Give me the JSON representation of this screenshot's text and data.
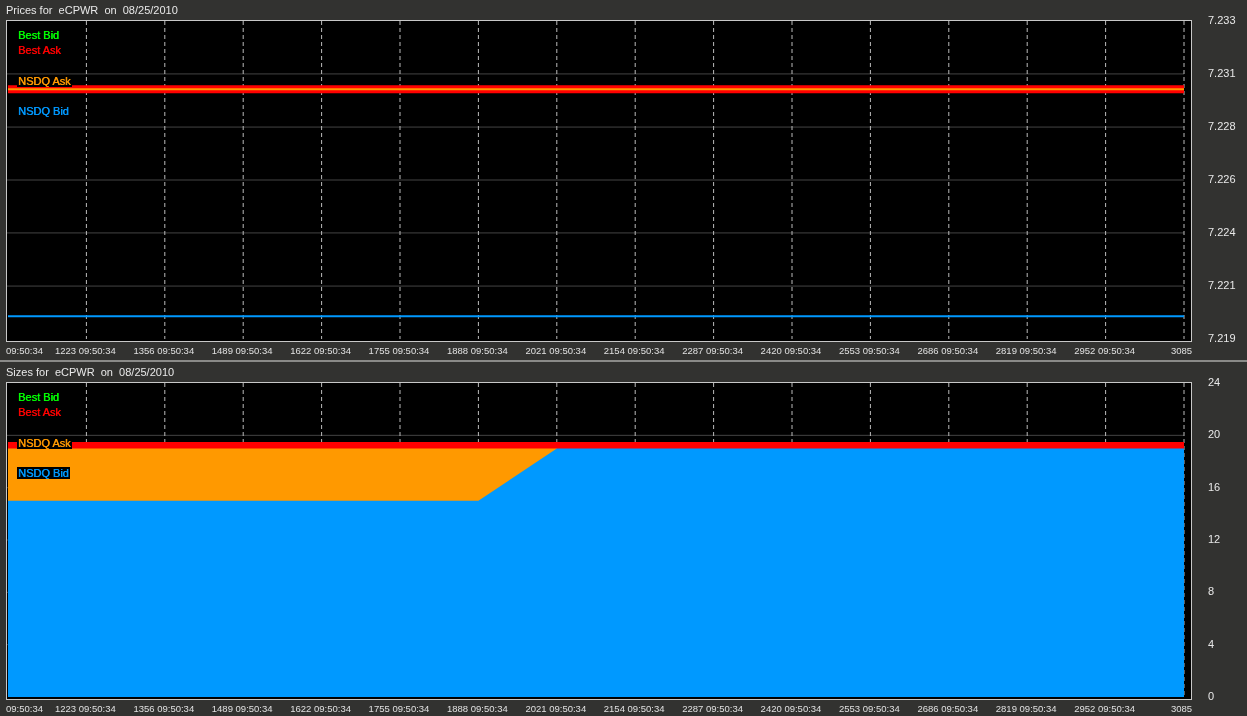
{
  "panels": [
    {
      "title": "Prices for  eCPWR  on  08/25/2010",
      "chart_data": {
        "type": "line",
        "grid": true,
        "categories": [
          "09:50:34",
          "1223 09:50:34",
          "1356 09:50:34",
          "1489 09:50:34",
          "1622 09:50:34",
          "1755 09:50:34",
          "1888 09:50:34",
          "2021 09:50:34",
          "2154 09:50:34",
          "2287 09:50:34",
          "2420 09:50:34",
          "2553 09:50:34",
          "2686 09:50:34",
          "2819 09:50:34",
          "2952 09:50:34",
          "3085"
        ],
        "ylim": [
          7.219,
          7.233
        ],
        "yticks": [
          {
            "value": 7.233,
            "label": "7.233"
          },
          {
            "value": 7.23067,
            "label": "7.231"
          },
          {
            "value": 7.22833,
            "label": "7.228"
          },
          {
            "value": 7.226,
            "label": "7.226"
          },
          {
            "value": 7.22367,
            "label": "7.224"
          },
          {
            "value": 7.22133,
            "label": "7.221"
          },
          {
            "value": 7.219,
            "label": "7.219"
          }
        ],
        "series": [
          {
            "name": "NSDQ Bid",
            "color": "#0099ff",
            "values": [
              7.22,
              7.22,
              7.22,
              7.22,
              7.22,
              7.22,
              7.22,
              7.22,
              7.22,
              7.22,
              7.22,
              7.22,
              7.22,
              7.22,
              7.22,
              7.22
            ]
          },
          {
            "name": "NSDQ Ask",
            "color": "#ff9900",
            "values": [
              7.23,
              7.23,
              7.23,
              7.23,
              7.23,
              7.23,
              7.23,
              7.23,
              7.23,
              7.23,
              7.23,
              7.23,
              7.23,
              7.23,
              7.23,
              7.23
            ]
          },
          {
            "name": "Best Ask",
            "color": "#ff0000",
            "values": [
              7.23,
              7.23,
              7.23,
              7.23,
              7.23,
              7.23,
              7.23,
              7.23,
              7.23,
              7.23,
              7.23,
              7.23,
              7.23,
              7.23,
              7.23,
              7.23
            ]
          },
          {
            "name": "Best Bid",
            "color": "#00ff00",
            "values": [
              null,
              null,
              null,
              null,
              null,
              null,
              null,
              null,
              null,
              null,
              null,
              null,
              null,
              null,
              null,
              null
            ]
          }
        ]
      }
    },
    {
      "title": "Sizes for  eCPWR  on  08/25/2010",
      "chart_data": {
        "type": "area",
        "stacked": false,
        "grid": true,
        "categories": [
          "09:50:34",
          "1223 09:50:34",
          "1356 09:50:34",
          "1489 09:50:34",
          "1622 09:50:34",
          "1755 09:50:34",
          "1888 09:50:34",
          "2021 09:50:34",
          "2154 09:50:34",
          "2287 09:50:34",
          "2420 09:50:34",
          "2553 09:50:34",
          "2686 09:50:34",
          "2819 09:50:34",
          "2952 09:50:34",
          "3085"
        ],
        "ylim": [
          0,
          24
        ],
        "yticks": [
          {
            "value": 24,
            "label": "24"
          },
          {
            "value": 20,
            "label": "20"
          },
          {
            "value": 16,
            "label": "16"
          },
          {
            "value": 12,
            "label": "12"
          },
          {
            "value": 8,
            "label": "8"
          },
          {
            "value": 4,
            "label": "4"
          },
          {
            "value": 0,
            "label": "0"
          }
        ],
        "series": [
          {
            "name": "NSDQ Bid",
            "color": "#0099ff",
            "values": [
              15,
              15,
              15,
              15,
              15,
              15,
              15,
              19,
              19,
              19,
              19,
              19,
              19,
              19,
              19,
              19
            ]
          },
          {
            "name": "NSDQ Ask",
            "color": "#ff9900",
            "values": [
              19,
              19,
              19,
              19,
              19,
              19,
              19,
              19,
              null,
              null,
              null,
              null,
              null,
              null,
              null,
              null
            ]
          },
          {
            "name": "Best Ask",
            "color": "#ff0000",
            "values": [
              19.5,
              19.5,
              19.5,
              19.5,
              19.5,
              19.5,
              19.5,
              19.5,
              19.5,
              19.5,
              19.5,
              19.5,
              19.5,
              19.5,
              19.5,
              19.5
            ]
          },
          {
            "name": "Best Bid",
            "color": "#00ff00",
            "values": [
              null,
              null,
              null,
              null,
              null,
              null,
              null,
              null,
              null,
              null,
              null,
              null,
              null,
              null,
              null,
              null
            ]
          }
        ]
      }
    }
  ]
}
